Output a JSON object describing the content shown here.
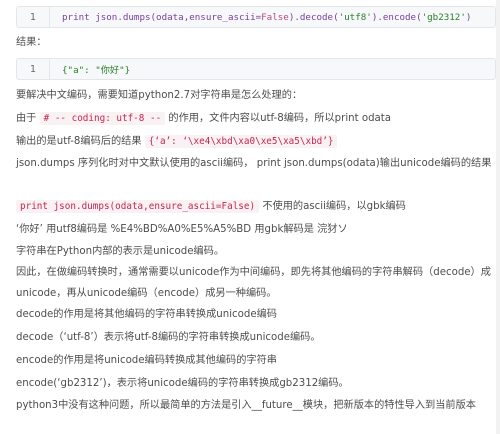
{
  "code1": {
    "line_no": "1",
    "parts": {
      "a": "print json.dumps(odata,ensure_ascii=",
      "b": "False",
      "c": ").decode(",
      "d": "'utf8'",
      "e": ").encode(",
      "f": "'gb2312'",
      "g": ")"
    }
  },
  "result_label": "结果：",
  "code2": {
    "line_no": "1",
    "text": "{\"a\": \"你好\"}"
  },
  "p1": "要解决中文编码，需要知道python2.7对字符串是怎么处理的：",
  "p2": {
    "a": "由于 ",
    "code": "# -- coding: utf-8 --",
    "b": " 的作用，文件内容以utf-8编码，所以print odata"
  },
  "p3": {
    "a": "输出的是utf-8编码后的结果 ",
    "code": "{‘a’: ‘\\xe4\\xbd\\xa0\\xe5\\xa5\\xbd’}"
  },
  "p4": "json.dumps 序列化时对中文默认使用的ascii编码， print json.dumps(odata)输出unicode编码的结果",
  "p5": {
    "code": "print json.dumps(odata,ensure_ascii=False)",
    "b": " 不使用的ascii编码，以gbk编码"
  },
  "p6": "‘你好’ 用utf8编码是 %E4%BD%A0%E5%A5%BD 用gbk解码是 浣犲ソ",
  "p7": "字符串在Python内部的表示是unicode编码。",
  "p8": "因此，在做编码转换时，通常需要以unicode作为中间编码，即先将其他编码的字符串解码（decode）成unicode，再从unicode编码（encode）成另一种编码。",
  "p9": "decode的作用是将其他编码的字符串转换成unicode编码",
  "p10": "decode（‘utf-8’）表示将utf-8编码的字符串转换成unicode编码。",
  "p11": "encode的作用是将unicode编码转换成其他编码的字符串",
  "p12": "encode(‘gb2312’)，表示将unicode编码的字符串转换成gb2312编码。",
  "p13": "python3中没有这种问题，所以最简单的方法是引入__future__模块，把新版本的特性导入到当前版本"
}
